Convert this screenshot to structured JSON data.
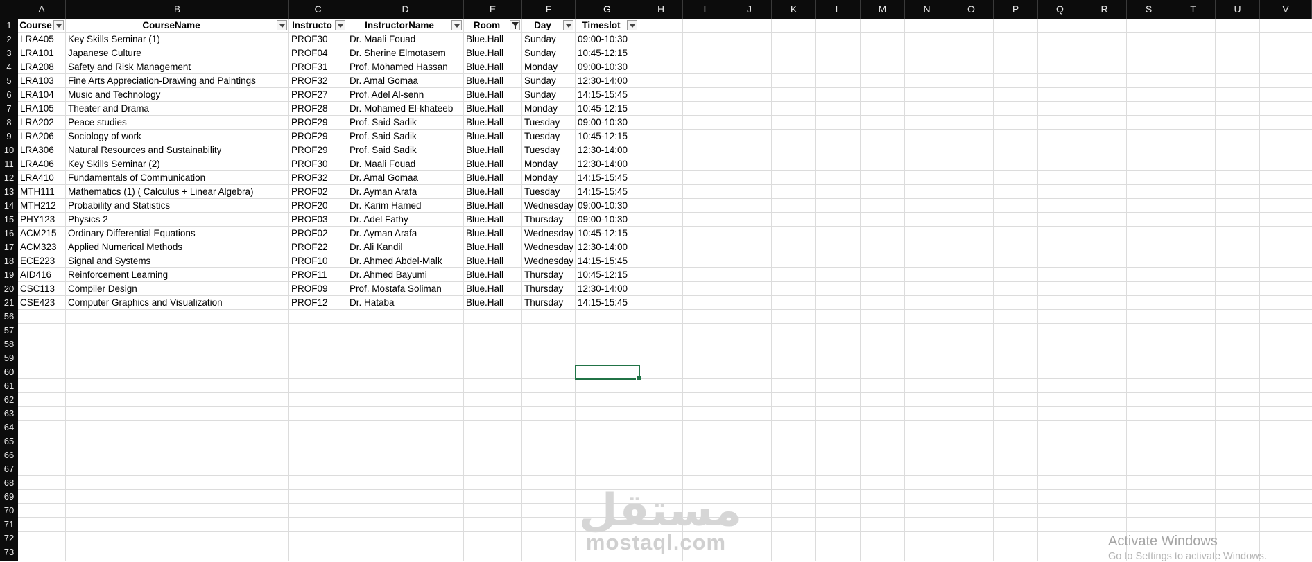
{
  "columns": [
    "A",
    "B",
    "C",
    "D",
    "E",
    "F",
    "G",
    "H",
    "I",
    "J",
    "K",
    "L",
    "M",
    "N",
    "O",
    "P",
    "Q",
    "R",
    "S",
    "T",
    "U",
    "V"
  ],
  "selected_column": "G",
  "headers": [
    "Course‌",
    "CourseName",
    "Instructo",
    "InstructorName",
    "Room",
    "Day",
    "Timeslot"
  ],
  "filtered_column": "Room",
  "rows": [
    {
      "n": "2",
      "course": "LRA405",
      "name": "Key Skills Seminar (1)",
      "instr": "PROF30",
      "iname": "Dr. Maali Fouad",
      "room": "Blue.Hall",
      "day": "Sunday",
      "slot": "09:00-10:30"
    },
    {
      "n": "3",
      "course": "LRA101",
      "name": "Japanese Culture",
      "instr": "PROF04",
      "iname": "Dr. Sherine Elmotasem",
      "room": "Blue.Hall",
      "day": "Sunday",
      "slot": "10:45-12:15"
    },
    {
      "n": "4",
      "course": "LRA208",
      "name": "Safety and Risk Management",
      "instr": "PROF31",
      "iname": "Prof. Mohamed Hassan",
      "room": "Blue.Hall",
      "day": "Monday",
      "slot": "09:00-10:30"
    },
    {
      "n": "5",
      "course": "LRA103",
      "name": "Fine Arts Appreciation-Drawing and Paintings",
      "instr": "PROF32",
      "iname": "Dr. Amal Gomaa",
      "room": "Blue.Hall",
      "day": "Sunday",
      "slot": "12:30-14:00"
    },
    {
      "n": "6",
      "course": "LRA104",
      "name": "Music and Technology",
      "instr": "PROF27",
      "iname": "Prof. Adel Al-senn",
      "room": "Blue.Hall",
      "day": "Sunday",
      "slot": "14:15-15:45"
    },
    {
      "n": "7",
      "course": "LRA105",
      "name": "Theater and Drama",
      "instr": "PROF28",
      "iname": "Dr. Mohamed El-khateeb",
      "room": "Blue.Hall",
      "day": "Monday",
      "slot": "10:45-12:15"
    },
    {
      "n": "8",
      "course": "LRA202",
      "name": "Peace studies",
      "instr": "PROF29",
      "iname": "Prof. Said Sadik",
      "room": "Blue.Hall",
      "day": "Tuesday",
      "slot": "09:00-10:30"
    },
    {
      "n": "9",
      "course": "LRA206",
      "name": "Sociology of work",
      "instr": "PROF29",
      "iname": "Prof. Said Sadik",
      "room": "Blue.Hall",
      "day": "Tuesday",
      "slot": "10:45-12:15"
    },
    {
      "n": "10",
      "course": "LRA306",
      "name": "Natural Resources and Sustainability",
      "instr": "PROF29",
      "iname": "Prof. Said Sadik",
      "room": "Blue.Hall",
      "day": "Tuesday",
      "slot": "12:30-14:00"
    },
    {
      "n": "11",
      "course": "LRA406",
      "name": "Key Skills Seminar (2)",
      "instr": "PROF30",
      "iname": "Dr. Maali Fouad",
      "room": "Blue.Hall",
      "day": "Monday",
      "slot": "12:30-14:00"
    },
    {
      "n": "12",
      "course": "LRA410",
      "name": "Fundamentals of Communication",
      "instr": "PROF32",
      "iname": "Dr. Amal Gomaa",
      "room": "Blue.Hall",
      "day": "Monday",
      "slot": "14:15-15:45"
    },
    {
      "n": "13",
      "course": "MTH111",
      "name": "Mathematics (1) ( Calculus + Linear Algebra)",
      "instr": "PROF02",
      "iname": "Dr. Ayman Arafa",
      "room": "Blue.Hall",
      "day": "Tuesday",
      "slot": "14:15-15:45"
    },
    {
      "n": "14",
      "course": "MTH212",
      "name": "Probability and Statistics",
      "instr": "PROF20",
      "iname": "Dr. Karim Hamed",
      "room": "Blue.Hall",
      "day": "Wednesday",
      "slot": "09:00-10:30"
    },
    {
      "n": "15",
      "course": "PHY123",
      "name": "Physics 2",
      "instr": "PROF03",
      "iname": "Dr. Adel Fathy",
      "room": "Blue.Hall",
      "day": "Thursday",
      "slot": "09:00-10:30"
    },
    {
      "n": "16",
      "course": "ACM215",
      "name": "Ordinary Differential Equations",
      "instr": "PROF02",
      "iname": "Dr. Ayman Arafa",
      "room": "Blue.Hall",
      "day": "Wednesday",
      "slot": "10:45-12:15"
    },
    {
      "n": "17",
      "course": "ACM323",
      "name": "Applied Numerical Methods",
      "instr": "PROF22",
      "iname": "Dr. Ali Kandil",
      "room": "Blue.Hall",
      "day": "Wednesday",
      "slot": "12:30-14:00"
    },
    {
      "n": "18",
      "course": "ECE223",
      "name": "Signal and Systems",
      "instr": "PROF10",
      "iname": "Dr. Ahmed Abdel-Malk",
      "room": "Blue.Hall",
      "day": "Wednesday",
      "slot": "14:15-15:45"
    },
    {
      "n": "19",
      "course": "AID416",
      "name": "Reinforcement Learning",
      "instr": "PROF11",
      "iname": "Dr. Ahmed Bayumi",
      "room": "Blue.Hall",
      "day": "Thursday",
      "slot": "10:45-12:15"
    },
    {
      "n": "20",
      "course": "CSC113",
      "name": "Compiler Design",
      "instr": "PROF09",
      "iname": "Prof. Mostafa Soliman",
      "room": "Blue.Hall",
      "day": "Thursday",
      "slot": "12:30-14:00"
    },
    {
      "n": "21",
      "course": "CSE423",
      "name": "Computer Graphics and Visualization",
      "instr": "PROF12",
      "iname": "Dr. Hataba",
      "room": "Blue.Hall",
      "day": "Thursday",
      "slot": "14:15-15:45"
    }
  ],
  "empty_rows": [
    "56",
    "57",
    "58",
    "59",
    "60",
    "61",
    "62",
    "63",
    "64",
    "65",
    "66",
    "67",
    "68",
    "69",
    "70",
    "71",
    "72",
    "73"
  ],
  "header_row_number": "1",
  "selected_row": "60",
  "watermark": {
    "arabic": "مستقل",
    "latin": "mostaql.com"
  },
  "activation": {
    "title": "Activate Windows",
    "subtitle": "Go to Settings to activate Windows."
  },
  "colors": {
    "header_bg": "#0c0c0c",
    "selection": "#217346",
    "gridline": "#dcdcdc"
  }
}
